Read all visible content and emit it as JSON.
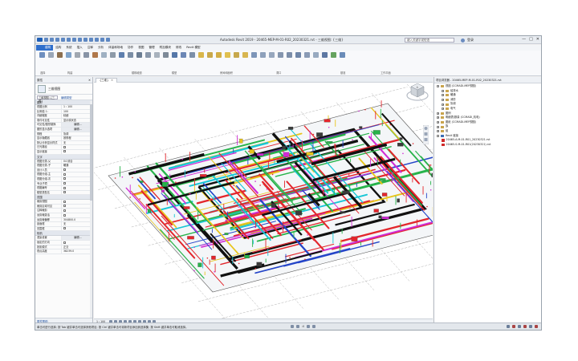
{
  "app": {
    "title": "Autodesk Revit 2019 - 20465-MEP-M-01-R02_20230321.rvt - 三维视图: {三维}",
    "search_value": "键入关键字或短语",
    "user_name": "登录",
    "window_controls": [
      "—",
      "□",
      "✕"
    ]
  },
  "ribbon": {
    "tabs": [
      "建筑",
      "结构",
      "系统",
      "插入",
      "注释",
      "分析",
      "体量和场地",
      "协作",
      "视图",
      "管理",
      "附加模块",
      "修改",
      "Revit 模型"
    ],
    "active_tab_index": 0,
    "panel_labels": [
      "选择",
      "构建",
      "楼梯坡道",
      "模型",
      "房间和面积",
      "洞口",
      "基准",
      "工作平面"
    ]
  },
  "properties": {
    "title": "属性",
    "close": "✕",
    "type_name": "三维视图",
    "filter_value": "三维视图: {三维}",
    "edit_type": "编辑类型",
    "groups": [
      {
        "name": "图形",
        "rows": [
          {
            "k": "视图比例",
            "v": "1 : 100"
          },
          {
            "k": "比例值 1:",
            "v": "100"
          },
          {
            "k": "详细程度",
            "v": "精细"
          },
          {
            "k": "零件可见性",
            "v": "显示原状态"
          },
          {
            "k": "可见性/图形替换",
            "v": "编辑..."
          },
          {
            "k": "图形显示选项",
            "v": "编辑..."
          },
          {
            "k": "规程",
            "v": "协调"
          },
          {
            "k": "显示隐藏线",
            "v": "按规程"
          },
          {
            "k": "默认分析显示样式",
            "v": "无"
          },
          {
            "k": "日光路径",
            "v": ""
          },
          {
            "k": "显示链接",
            "v": ""
          }
        ]
      },
      {
        "name": "文字",
        "rows": [
          {
            "k": "视图分类-父",
            "v": "04 综合"
          },
          {
            "k": "视图分类-子",
            "v": "暖通"
          },
          {
            "k": "设计人员",
            "v": ""
          },
          {
            "k": "视图分组-主",
            "v": ""
          },
          {
            "k": "视图分组-次",
            "v": ""
          },
          {
            "k": "专业子项",
            "v": ""
          },
          {
            "k": "视图编号",
            "v": ""
          },
          {
            "k": "模型类型名",
            "v": ""
          }
        ]
      },
      {
        "name": "范围",
        "rows": [
          {
            "k": "裁剪视图",
            "v": ""
          },
          {
            "k": "裁剪区域可见",
            "v": ""
          },
          {
            "k": "注释裁剪",
            "v": ""
          },
          {
            "k": "远剪裁激活",
            "v": ""
          },
          {
            "k": "远剪裁偏移",
            "v": "304800.0"
          },
          {
            "k": "剖面框",
            "v": "无"
          },
          {
            "k": "范围框",
            "v": ""
          }
        ]
      },
      {
        "name": "相机",
        "rows": [
          {
            "k": "渲染设置",
            "v": "编辑..."
          },
          {
            "k": "锁定的方向",
            "v": ""
          },
          {
            "k": "投影模式",
            "v": "正交"
          },
          {
            "k": "视点高度",
            "v": "38239.0"
          }
        ]
      }
    ],
    "footer": "属性帮助",
    "apply": "应用"
  },
  "viewport": {
    "tab_label": "{三维}",
    "tab_close": "✕",
    "scale": "1 : 100",
    "viewcube": "上"
  },
  "browser": {
    "title": "项目浏览器 - 20465-MEP-M-01-R02_20230321.rvt",
    "nodes": [
      {
        "label": "视图 (CCMADI-MEP视图)",
        "level": 0,
        "toggle": "−",
        "kind": "folder"
      },
      {
        "label": "给排水",
        "level": 1,
        "toggle": "+",
        "kind": "folder"
      },
      {
        "label": "暖通",
        "level": 1,
        "toggle": "+",
        "kind": "folder"
      },
      {
        "label": "消防",
        "level": 1,
        "toggle": "+",
        "kind": "folder"
      },
      {
        "label": "协调",
        "level": 1,
        "toggle": "+",
        "kind": "folder"
      },
      {
        "label": "电气",
        "level": 1,
        "toggle": "+",
        "kind": "folder"
      },
      {
        "label": "图例",
        "level": 0,
        "toggle": "+",
        "kind": "folder"
      },
      {
        "label": "明细表/数量 (CCMADI_机电)",
        "level": 0,
        "toggle": "+",
        "kind": "folder"
      },
      {
        "label": "图纸 (CCMADI-MEP视图)",
        "level": 0,
        "toggle": "+",
        "kind": "folder"
      },
      {
        "label": "族",
        "level": 0,
        "toggle": "+",
        "kind": "folder"
      },
      {
        "label": "组",
        "level": 0,
        "toggle": "+",
        "kind": "folder"
      },
      {
        "label": "Revit 链接",
        "level": 0,
        "toggle": "−",
        "kind": "link"
      },
      {
        "label": "20465-A-M-01-R01_20230321.rvt",
        "level": 1,
        "toggle": "",
        "kind": "rvt"
      },
      {
        "label": "20465-S-M-01-R01(20230321).rvt",
        "level": 1,
        "toggle": "",
        "kind": "rvt"
      }
    ]
  },
  "statusbar": {
    "text": "单击可进行选择; 按 Tab 键并单击可选择其他项目; 按 Ctrl 键并单击可将新项目添加到选择集; 按 Shift 键并单击可取消选择。",
    "zoom": ":0"
  },
  "colors": {
    "accent": "#2f6fcc",
    "pipe_red": "#e3262c",
    "pipe_green": "#27b34a",
    "pipe_cyan": "#18c6d6",
    "pipe_magenta": "#d02bd4",
    "pipe_yellow": "#e8c51c",
    "pipe_blue": "#2445c8",
    "duct_black": "#111111"
  }
}
